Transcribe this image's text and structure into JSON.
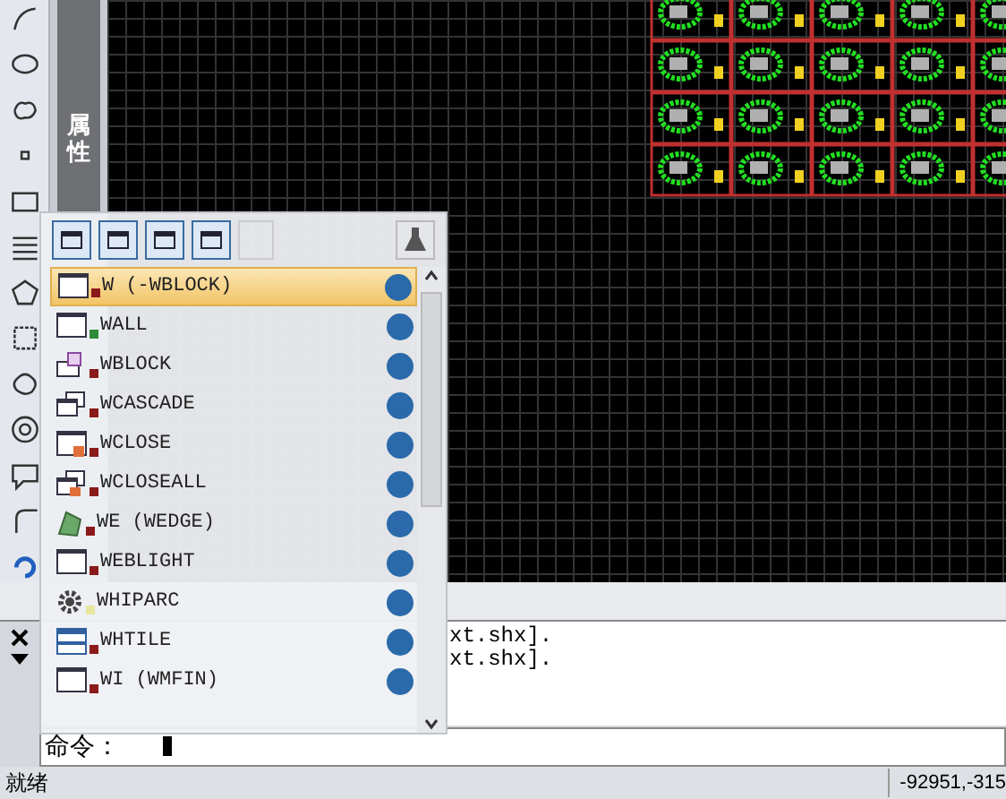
{
  "side_tab": {
    "label": "属性"
  },
  "popup": {
    "items": [
      {
        "label": "W (-WBLOCK)",
        "selected": true,
        "color": "#8b1a1a"
      },
      {
        "label": "WALL",
        "selected": false,
        "color": "#2e8b3a"
      },
      {
        "label": "WBLOCK",
        "selected": false,
        "color": "#8b1a1a"
      },
      {
        "label": "WCASCADE",
        "selected": false,
        "color": "#8b1a1a"
      },
      {
        "label": "WCLOSE",
        "selected": false,
        "color": "#8b1a1a"
      },
      {
        "label": "WCLOSEALL",
        "selected": false,
        "color": "#8b1a1a"
      },
      {
        "label": "WE (WEDGE)",
        "selected": false,
        "color": "#8b1a1a"
      },
      {
        "label": "WEBLIGHT",
        "selected": false,
        "color": "#8b1a1a"
      },
      {
        "label": "WHIPARC",
        "selected": false,
        "color": "#e8e6a0"
      },
      {
        "label": "WHTILE",
        "selected": false,
        "color": "#8b1a1a"
      },
      {
        "label": "WI (WMFIN)",
        "selected": false,
        "color": "#8b1a1a"
      }
    ]
  },
  "history": [
    "xt.shx].",
    "xt.shx]."
  ],
  "command": {
    "prompt": "命令："
  },
  "status_bar": {
    "state": "就绪",
    "coords": "-92951,-315"
  }
}
